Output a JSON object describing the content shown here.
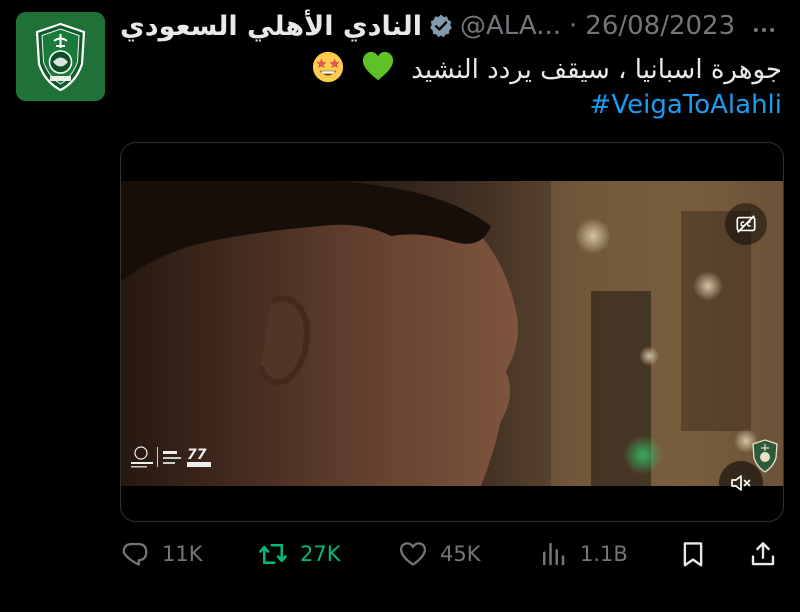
{
  "author": {
    "name": "النادي الأهلي السعودي",
    "handle": "@ALA...",
    "separator": "·",
    "date": "26/08/2023"
  },
  "tweet": {
    "text": "جوهرة اسبانيا ، سيقف يردد النشيد",
    "hashtag": "#VeigaToAlahli"
  },
  "media": {
    "cc_label": "cc",
    "logos": {
      "left": "Red Sea Global",
      "crest": "Al-Ahli"
    }
  },
  "actions": {
    "replies": "11K",
    "retweets": "27K",
    "likes": "45K",
    "views": "1.1B"
  },
  "colors": {
    "background": "#000000",
    "text": "#e7e9ea",
    "muted": "#71767b",
    "link": "#1d9bf0",
    "retweet_active": "#00ba7c",
    "verified": "#829aab",
    "club_green": "#1c6b34"
  },
  "icons": {
    "verified": "verified-badge-icon",
    "more": "more-options-icon",
    "reply": "reply-icon",
    "retweet": "retweet-icon",
    "like": "heart-icon",
    "views": "views-chart-icon",
    "bookmark": "bookmark-icon",
    "share": "share-icon",
    "cc": "closed-captions-icon",
    "mute": "muted-speaker-icon"
  }
}
